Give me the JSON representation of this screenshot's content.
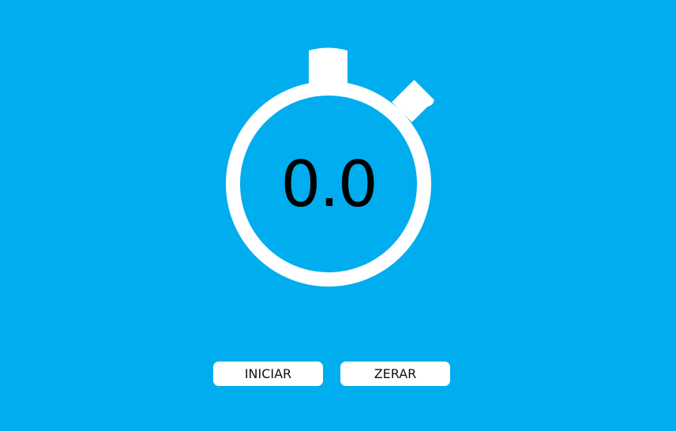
{
  "stopwatch": {
    "time": "0.0"
  },
  "controls": {
    "start_label": "INICIAR",
    "reset_label": "ZERAR"
  },
  "colors": {
    "background": "#00adef",
    "watch": "#ffffff",
    "text": "#000000"
  }
}
